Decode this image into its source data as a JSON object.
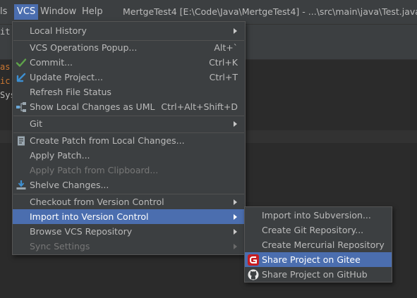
{
  "menubar": {
    "items": [
      {
        "label": "ls"
      },
      {
        "label": "VCS",
        "selected": true
      },
      {
        "label": "Window"
      },
      {
        "label": "Help"
      }
    ],
    "title": "MertgeTest4 [E:\\Code\\Java\\MertgeTest4] - ...\\src\\main\\java\\Test.java - I"
  },
  "editor": {
    "left_fragments": [
      {
        "text": "it:",
        "color": "#bbbbbb"
      },
      {
        "text": "as",
        "color": "#cc7832"
      },
      {
        "text": "ic",
        "color": "#cc7832"
      },
      {
        "text": "Sys",
        "color": "#bbbbbb"
      }
    ]
  },
  "vcs_menu": {
    "items": [
      {
        "label": "Local History",
        "mnemonic": "H",
        "submenu": true
      },
      {
        "separator": true
      },
      {
        "label": "VCS Operations Popup...",
        "shortcut": "Alt+`"
      },
      {
        "label": "Commit...",
        "shortcut": "Ctrl+K",
        "icon": "check-icon"
      },
      {
        "label": "Update Project...",
        "shortcut": "Ctrl+T",
        "icon": "update-arrow-icon"
      },
      {
        "label": "Refresh File Status"
      },
      {
        "label": "Show Local Changes as UML",
        "shortcut": "Ctrl+Alt+Shift+D",
        "icon": "uml-diagram-icon"
      },
      {
        "separator": true
      },
      {
        "label": "Git",
        "submenu": true
      },
      {
        "separator": true
      },
      {
        "label": "Create Patch from Local Changes...",
        "icon": "patch-icon"
      },
      {
        "label": "Apply Patch..."
      },
      {
        "label": "Apply Patch from Clipboard...",
        "disabled": true
      },
      {
        "label": "Shelve Changes...",
        "icon": "shelve-icon"
      },
      {
        "separator": true
      },
      {
        "label": "Checkout from Version Control",
        "submenu": true
      },
      {
        "label": "Import into Version Control",
        "submenu": true,
        "highlighted": true
      },
      {
        "label": "Browse VCS Repository",
        "submenu": true
      },
      {
        "label": "Sync Settings",
        "submenu": true,
        "disabled": true
      }
    ]
  },
  "import_submenu": {
    "items": [
      {
        "label": "Import into Subversion..."
      },
      {
        "label": "Create Git Repository..."
      },
      {
        "label": "Create Mercurial Repository"
      },
      {
        "label": "Share Project on Gitee",
        "icon": "gitee-icon",
        "highlighted": true,
        "icon_color": "#c71d23"
      },
      {
        "label": "Share Project on GitHub",
        "icon": "github-icon"
      }
    ]
  },
  "colors": {
    "menu_bg": "#3c3f41",
    "highlight": "#4b6eaf",
    "editor_bg": "#2b2b2b",
    "check_green": "#5fa34a",
    "update_blue": "#3d8fd1"
  }
}
